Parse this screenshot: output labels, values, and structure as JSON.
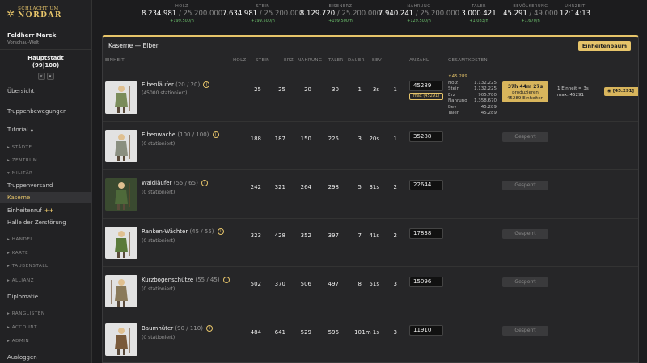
{
  "app": {
    "logo_top": "SCHLACHT UM",
    "logo_main": "NORDAR"
  },
  "player": {
    "name": "Feldherr Marek",
    "world": "Vorschau-Welt"
  },
  "capital": {
    "name": "Hauptstadt",
    "coords": "(99|100)",
    "btn_close": "×",
    "btn_menu": "▾"
  },
  "nav": {
    "overview": "Übersicht",
    "troop_moves": "Truppenbewegungen",
    "tutorial": "Tutorial",
    "tutorial_dot": "●",
    "staedte": "▸ STÄDTE",
    "zentrum": "▸ ZENTRUM",
    "militaer": "▾ MILITÄR",
    "truppenversand": "Truppenversand",
    "kaserne": "Kaserne",
    "einheitenruf": "Einheitenruf",
    "einheitenruf_plus": "++",
    "halle": "Halle der Zerstörung",
    "handel": "▸ HANDEL",
    "karte": "▸ KARTE",
    "taubenstall": "▸ TAUBENSTALL",
    "allianz": "▸ ALLIANZ",
    "diplomatie": "Diplomatie",
    "ranglisten": "▸ RANGLISTEN",
    "account": "▸ ACCOUNT",
    "admin": "▸ ADMIN",
    "logout": "Ausloggen"
  },
  "resources": [
    {
      "label": "HOLZ",
      "value": "8.234.981",
      "max": " / 25.200.000",
      "rate": "+199.500/h"
    },
    {
      "label": "STEIN",
      "value": "7.634.981",
      "max": " / 25.200.000",
      "rate": "+199.500/h"
    },
    {
      "label": "EISENERZ",
      "value": "8.129.720",
      "max": " / 25.200.000",
      "rate": "+199.500/h"
    },
    {
      "label": "NAHRUNG",
      "value": "7.940.241",
      "max": " / 25.200.000",
      "rate": "+129.500/h"
    },
    {
      "label": "TALER",
      "value": "3.000.421",
      "max": "",
      "rate": "+1.083/h"
    },
    {
      "label": "BEVÖLKERUNG",
      "value": "45.291",
      "max": " / 49.000",
      "rate": "+1.670/h"
    },
    {
      "label": "UHRZEIT",
      "value": "12:14:13",
      "max": "",
      "rate": ""
    }
  ],
  "panel": {
    "title": "Kaserne — Elben",
    "tree_button": "Einheitenbaum",
    "headers": {
      "unit": "EINHEIT",
      "holz": "HOLZ",
      "stein": "STEIN",
      "erz": "ERZ",
      "nahrung": "NAHRUNG",
      "taler": "TALER",
      "dauer": "DAUER",
      "bev": "BEV",
      "anzahl": "ANZAHL",
      "gesamtkosten": "GESAMTKOSTEN"
    }
  },
  "units": [
    {
      "name": "Elbenläufer",
      "count": "(20 / 20)",
      "stationed": "(45000 stationiert)",
      "holz": "25",
      "stein": "25",
      "erz": "20",
      "nahrung": "30",
      "taler": "1",
      "dauer": "3s",
      "bev": "1",
      "amount": "45289"
    },
    {
      "name": "Elbenwache",
      "count": "(100 / 100)",
      "stationed": "(0 stationiert)",
      "holz": "188",
      "stein": "187",
      "erz": "150",
      "nahrung": "225",
      "taler": "3",
      "dauer": "20s",
      "bev": "1",
      "amount": "35288"
    },
    {
      "name": "Waldläufer",
      "count": "(55 / 65)",
      "stationed": "(0 stationiert)",
      "holz": "242",
      "stein": "321",
      "erz": "264",
      "nahrung": "298",
      "taler": "5",
      "dauer": "31s",
      "bev": "2",
      "amount": "22644"
    },
    {
      "name": "Ranken-Wächter",
      "count": "(45 / 55)",
      "stationed": "(0 stationiert)",
      "holz": "323",
      "stein": "428",
      "erz": "352",
      "nahrung": "397",
      "taler": "7",
      "dauer": "41s",
      "bev": "2",
      "amount": "17838"
    },
    {
      "name": "Kurzbogenschütze",
      "count": "(55 / 45)",
      "stationed": "(0 stationiert)",
      "holz": "502",
      "stein": "370",
      "erz": "506",
      "nahrung": "497",
      "taler": "8",
      "dauer": "51s",
      "bev": "3",
      "amount": "15096"
    },
    {
      "name": "Baumhüter",
      "count": "(90 / 110)",
      "stationed": "(0 stationiert)",
      "holz": "484",
      "stein": "641",
      "erz": "529",
      "nahrung": "596",
      "taler": "10",
      "dauer": "1m 1s",
      "bev": "3",
      "amount": "11910"
    }
  ],
  "first_unit_extra": {
    "max_button": "max (45291)",
    "costs_head": "×45.289",
    "costs": [
      {
        "label": "Holz",
        "value": "1.132.225"
      },
      {
        "label": "Stein",
        "value": "1.132.225"
      },
      {
        "label": "Erz",
        "value": "905.780"
      },
      {
        "label": "Nahrung",
        "value": "1.358.670"
      },
      {
        "label": "Bev",
        "value": "45.289"
      },
      {
        "label": "Taler",
        "value": "45.289"
      }
    ],
    "produce_time": "37h 44m 27s",
    "produce_label": "produzieren",
    "produce_units": "45289 Einheiten",
    "rate_info": "1 Einheit = 3s",
    "max_info": "max. 45291",
    "gold_button": "[45.291]",
    "gold_icon": "coin-icon"
  },
  "locked_label": "Gesperrt",
  "colors": {
    "accent": "#e6c46a",
    "bg": "#1c1c1e",
    "panel": "#262628",
    "rate_green": "#6cbf6c"
  }
}
